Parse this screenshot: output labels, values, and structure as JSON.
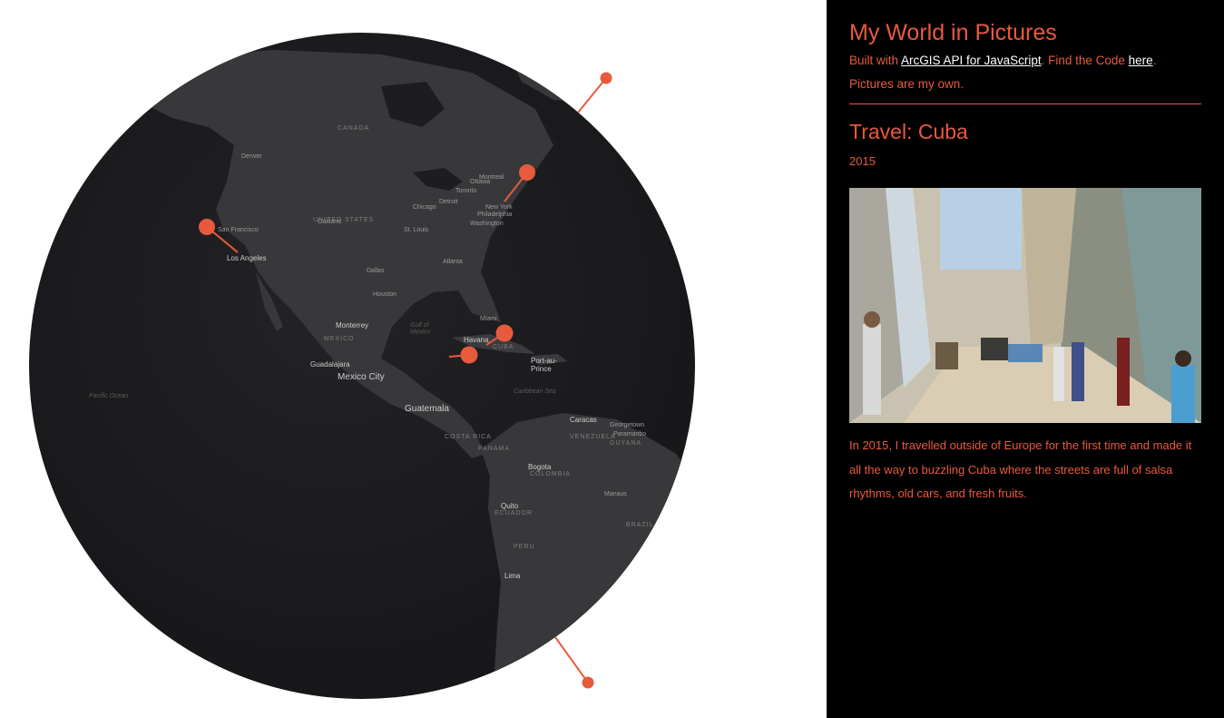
{
  "map": {
    "places": [
      {
        "id": "san-francisco",
        "label": "San Francisco"
      },
      {
        "id": "oakland",
        "label": "Oakland"
      },
      {
        "id": "los-angeles",
        "label": "Los Angeles"
      },
      {
        "id": "denver",
        "label": "Denver"
      },
      {
        "id": "chicago",
        "label": "Chicago"
      },
      {
        "id": "st-louis",
        "label": "St. Louis"
      },
      {
        "id": "dallas",
        "label": "Dallas"
      },
      {
        "id": "houston",
        "label": "Houston"
      },
      {
        "id": "atlanta",
        "label": "Atlanta"
      },
      {
        "id": "miami",
        "label": "Miami"
      },
      {
        "id": "washington",
        "label": "Washington"
      },
      {
        "id": "philadelphia",
        "label": "Philadelphia"
      },
      {
        "id": "new-york",
        "label": "New York"
      },
      {
        "id": "toronto",
        "label": "Toronto"
      },
      {
        "id": "montreal",
        "label": "Montreal"
      },
      {
        "id": "ottawa",
        "label": "Ottawa"
      },
      {
        "id": "detroit",
        "label": "Detroit"
      },
      {
        "id": "monterrey",
        "label": "Monterrey"
      },
      {
        "id": "guadalajara",
        "label": "Guadalajara"
      },
      {
        "id": "mexico-city",
        "label": "Mexico City"
      },
      {
        "id": "havana",
        "label": "Havana"
      },
      {
        "id": "port-au-prince",
        "label": "Port-au-\nPrince"
      },
      {
        "id": "guatemala",
        "label": "Guatemala"
      },
      {
        "id": "caracas",
        "label": "Caracas"
      },
      {
        "id": "bogota",
        "label": "Bogota"
      },
      {
        "id": "quito",
        "label": "Quito"
      },
      {
        "id": "lima",
        "label": "Lima"
      },
      {
        "id": "georgetown",
        "label": "Georgetown"
      },
      {
        "id": "paramaribo",
        "label": "Paramaribo"
      },
      {
        "id": "manaus",
        "label": "Manaus"
      }
    ],
    "regions": [
      {
        "id": "united-states",
        "label": "UNITED STATES"
      },
      {
        "id": "canada",
        "label": "CANADA"
      },
      {
        "id": "mexico",
        "label": "MEXICO"
      },
      {
        "id": "cuba",
        "label": "CUBA"
      },
      {
        "id": "costa-rica",
        "label": "COSTA RICA"
      },
      {
        "id": "panama",
        "label": "PANAMA"
      },
      {
        "id": "colombia",
        "label": "COLOMBIA"
      },
      {
        "id": "ecuador",
        "label": "ECUADOR"
      },
      {
        "id": "peru",
        "label": "PERU"
      },
      {
        "id": "venezuela",
        "label": "VENEZUELA"
      },
      {
        "id": "guyana",
        "label": "GUYANA"
      },
      {
        "id": "brazil",
        "label": "BRAZIL"
      }
    ],
    "water": [
      {
        "id": "pacific-ocean",
        "label": "Pacific Ocean"
      },
      {
        "id": "gulf-of-mexico",
        "label": "Gulf of\nMexico"
      },
      {
        "id": "caribbean-sea",
        "label": "Caribbean Sea"
      }
    ],
    "colors": {
      "globe": "#1d1d20",
      "land": "#38383b",
      "marker": "#e85a3d"
    }
  },
  "panel": {
    "title": "My World in Pictures",
    "built_with_prefix": "Built with ",
    "arcgis_link": "ArcGIS API for JavaScript",
    "find_code_text": ". Find the Code ",
    "here_link": "here",
    "period": ".",
    "pictures_note": "Pictures are my own.",
    "travel_title": "Travel: Cuba",
    "year": "2015",
    "photo_icon": "street-photo",
    "description": "In 2015, I travelled outside of Europe for the first time and made it all the way to buzzling Cuba where the streets are full of salsa rhythms, old cars, and fresh fruits."
  }
}
